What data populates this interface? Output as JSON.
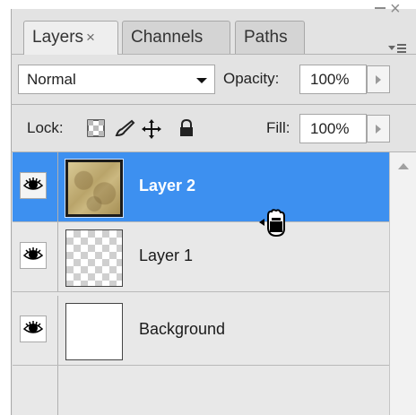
{
  "tabs": [
    {
      "label": "Layers",
      "close": "×",
      "active": true
    },
    {
      "label": "Channels",
      "active": false
    },
    {
      "label": "Paths",
      "active": false
    }
  ],
  "window": {
    "minimize": "–",
    "close": "×"
  },
  "blend_mode": {
    "value": "Normal"
  },
  "opacity": {
    "label": "Opacity:",
    "value": "100%"
  },
  "lock": {
    "label": "Lock:",
    "icons": [
      "lock-transparent-icon",
      "lock-image-icon",
      "lock-position-icon",
      "lock-all-icon"
    ]
  },
  "fill": {
    "label": "Fill:",
    "value": "100%"
  },
  "layers": [
    {
      "name": "Layer 2",
      "selected": true,
      "visible": true,
      "thumbnail": "texture"
    },
    {
      "name": "Layer 1",
      "selected": false,
      "visible": true,
      "thumbnail": "transparent-checker"
    },
    {
      "name": "Background",
      "selected": false,
      "visible": true,
      "thumbnail": "white"
    }
  ],
  "colors": {
    "selection": "#3d90f0",
    "panel": "#e3e3e3"
  }
}
